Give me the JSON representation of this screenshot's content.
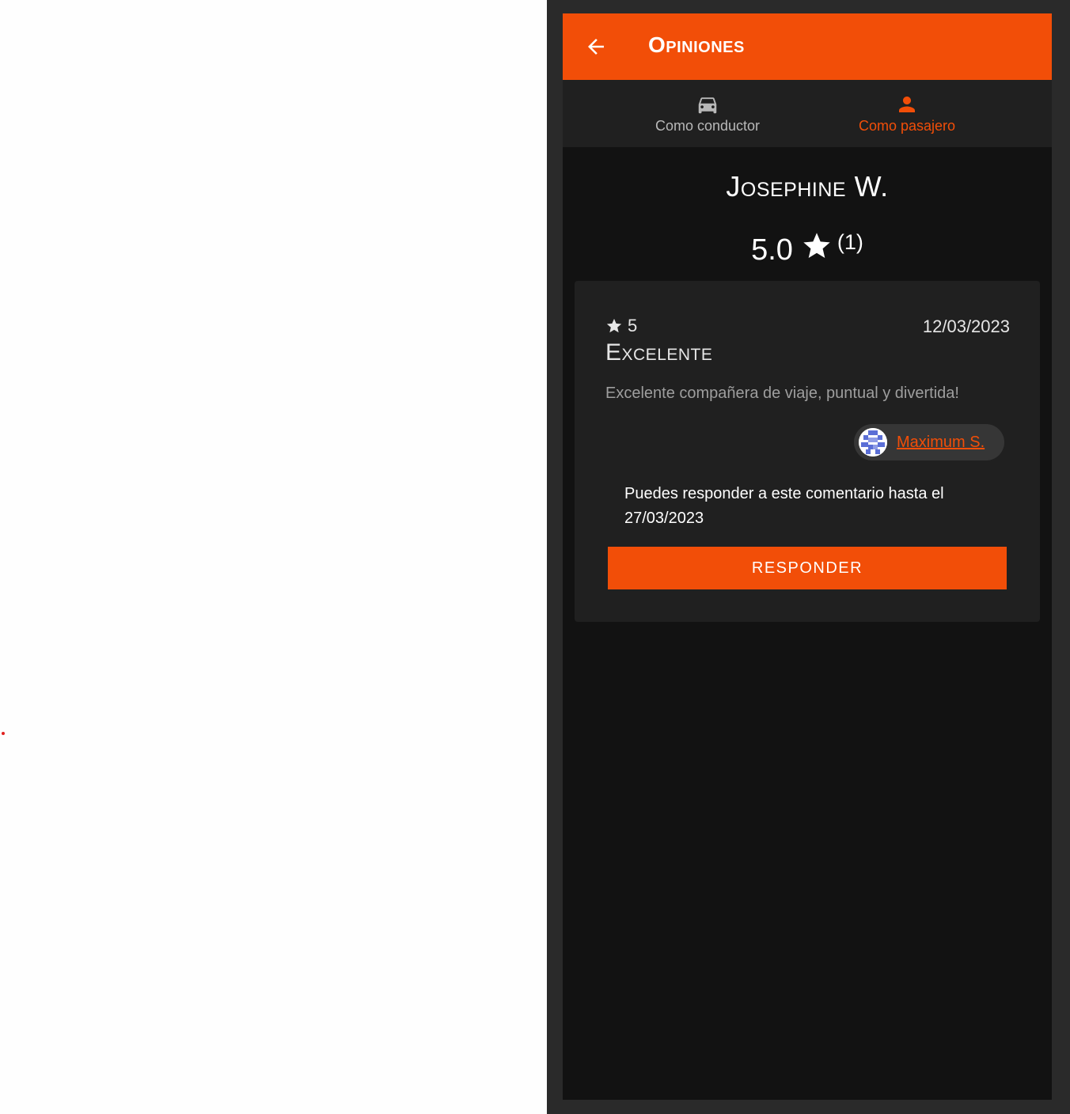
{
  "appbar": {
    "back_icon": "arrow-left-icon",
    "title": "Opiniones"
  },
  "tabs": [
    {
      "label": "Como conductor",
      "icon": "car-icon",
      "active": false
    },
    {
      "label": "Como pasajero",
      "icon": "person-icon",
      "active": true
    }
  ],
  "profile": {
    "name": "Josephine W.",
    "rating": "5.0",
    "rating_icon": "star-icon",
    "review_count": "(1)"
  },
  "review": {
    "score": "5",
    "date": "12/03/2023",
    "title": "Excelente",
    "text": "Excelente compañera de viaje, puntual y divertida!",
    "author": {
      "name": "Maximum S.",
      "avatar_icon": "identicon-avatar"
    },
    "reply_notice": "Puedes responder a este comentario hasta el 27/03/2023",
    "reply_button": "RESPONDER"
  },
  "colors": {
    "accent": "#f24e08",
    "background": "#121212",
    "surface": "#202020",
    "frame": "#2a2a2a"
  }
}
